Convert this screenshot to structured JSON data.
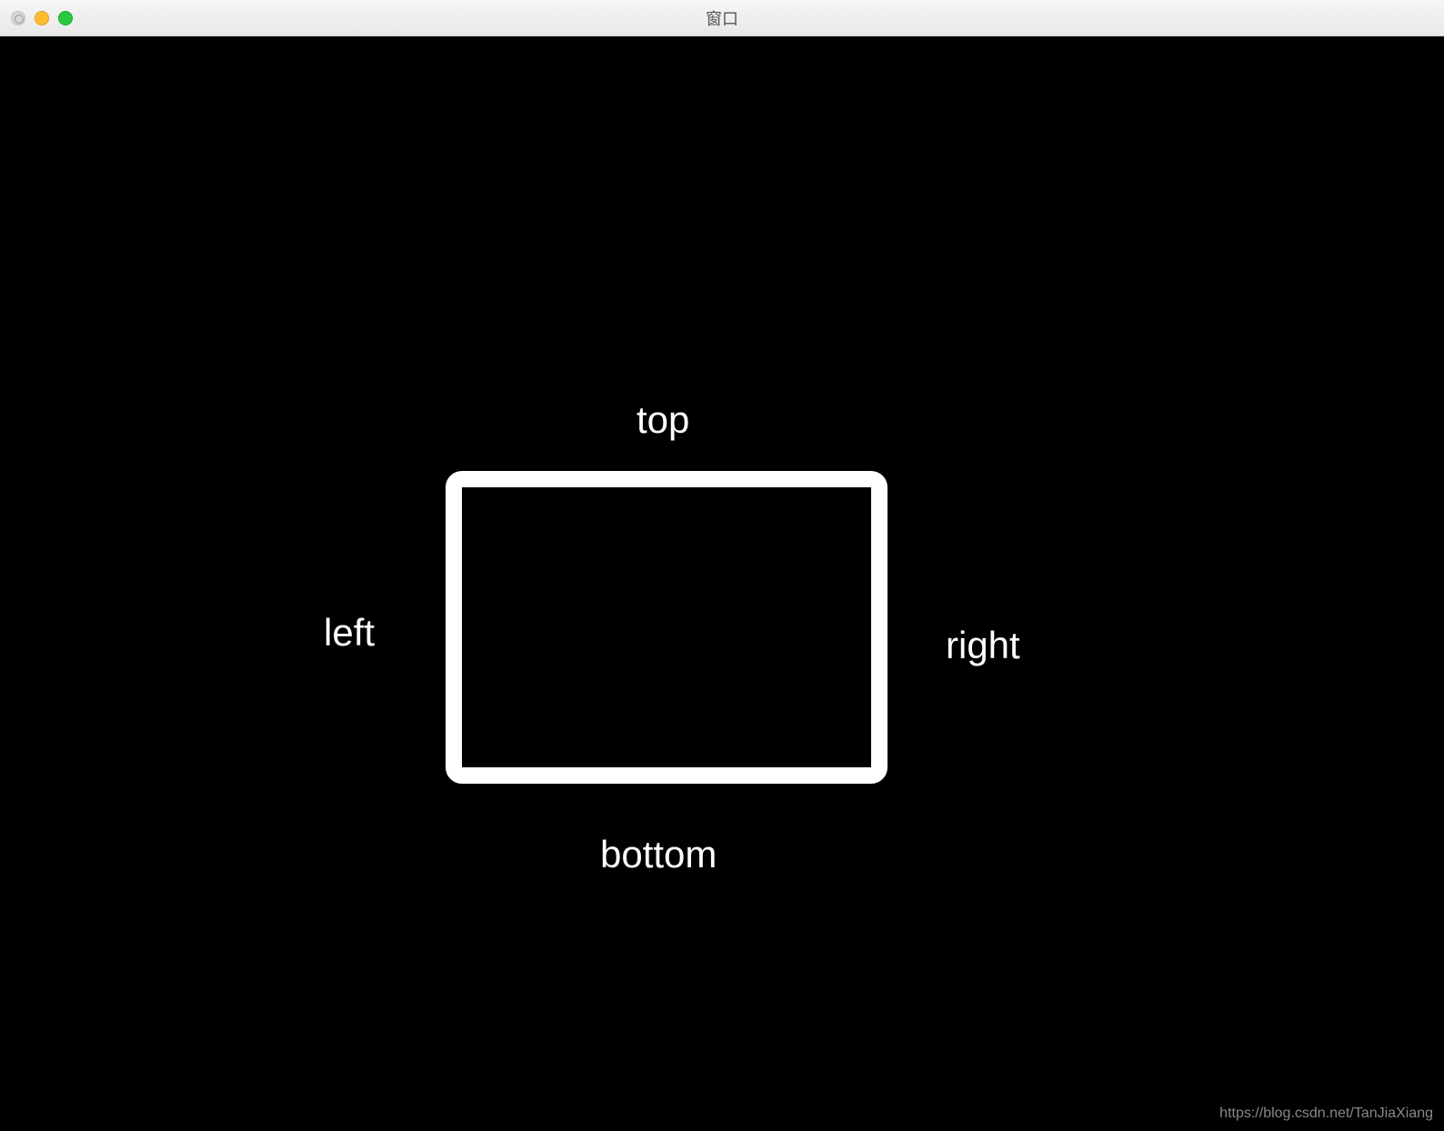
{
  "window": {
    "title": "窗口"
  },
  "labels": {
    "top": "top",
    "bottom": "bottom",
    "left": "left",
    "right": "right"
  },
  "watermark": "https://blog.csdn.net/TanJiaXiang",
  "colors": {
    "background": "#000000",
    "box_border": "#ffffff",
    "text": "#ffffff"
  }
}
